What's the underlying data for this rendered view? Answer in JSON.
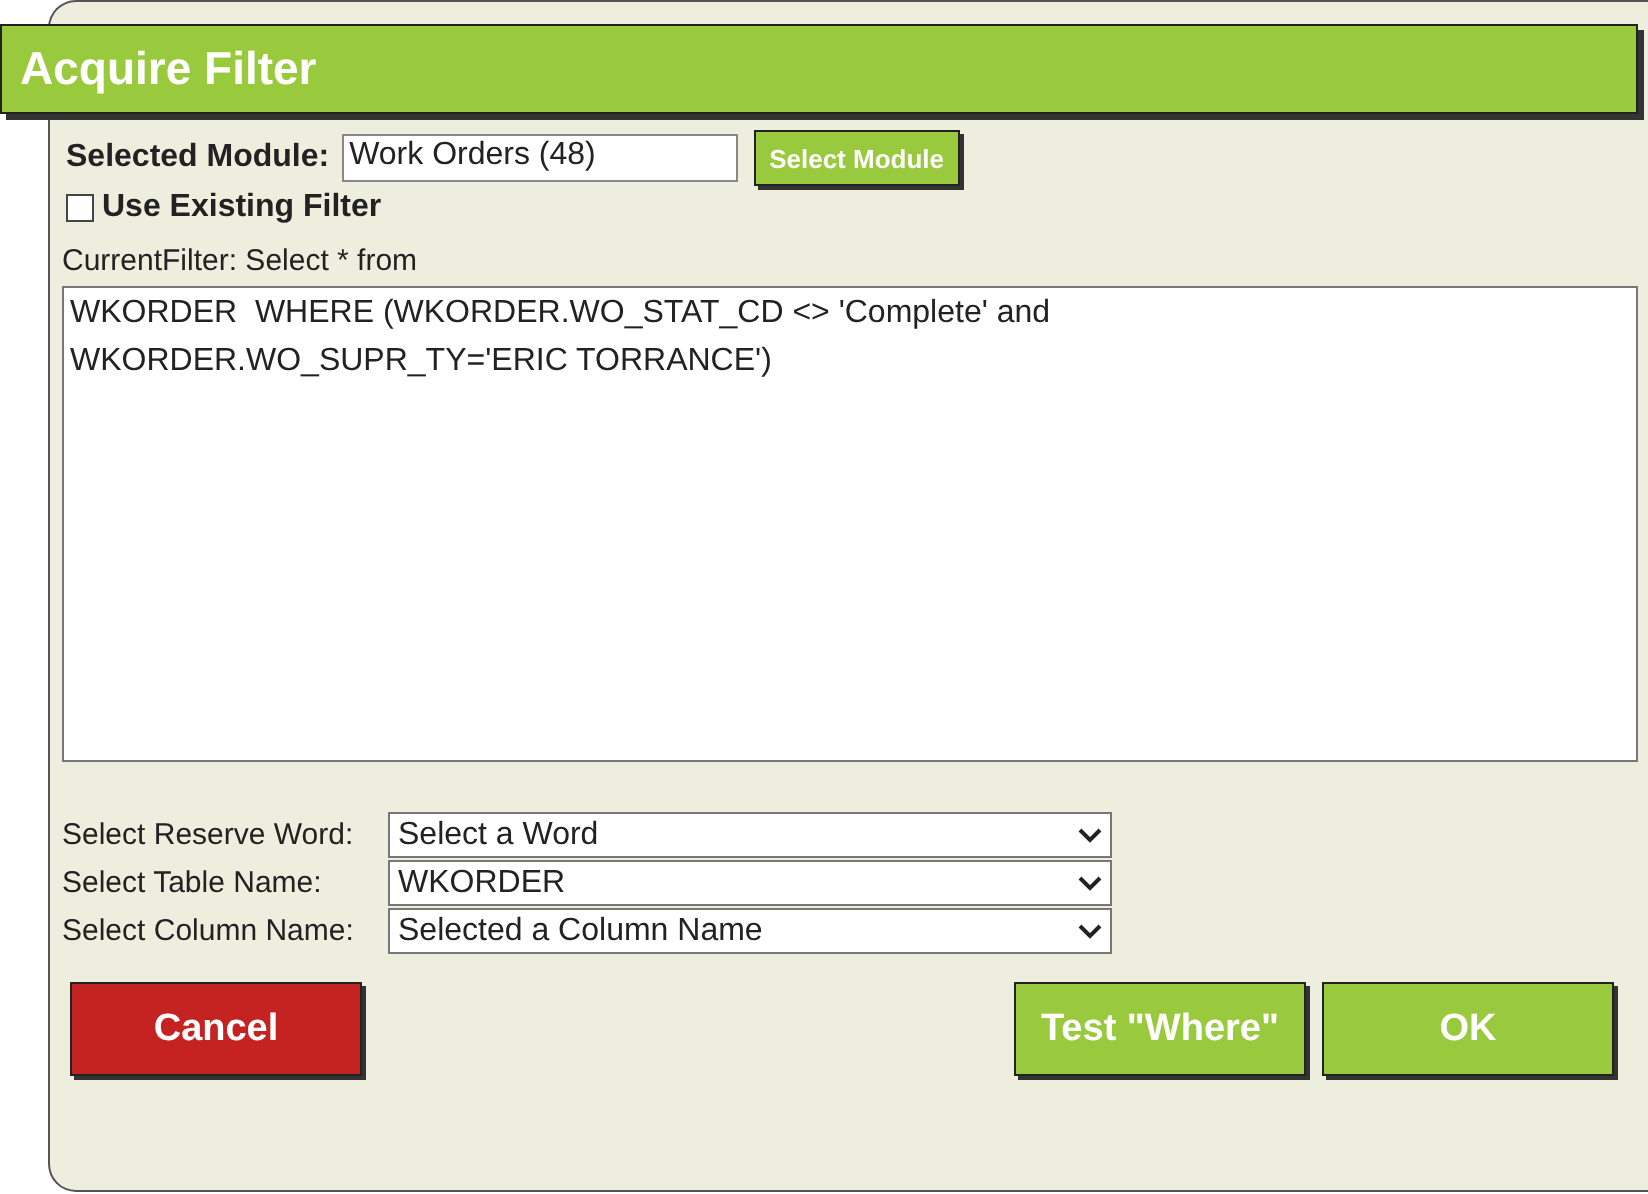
{
  "title": "Acquire Filter",
  "module": {
    "label": "Selected Module:",
    "value": "Work Orders (48)",
    "button": "Select Module"
  },
  "use_existing_filter": {
    "label": "Use Existing Filter",
    "checked": false
  },
  "current_filter": {
    "label": "CurrentFilter: Select * from",
    "value": "WKORDER  WHERE (WKORDER.WO_STAT_CD <> 'Complete' and WKORDER.WO_SUPR_TY='ERIC TORRANCE')"
  },
  "selectors": [
    {
      "label": "Select Reserve Word:",
      "value": "Select a Word"
    },
    {
      "label": "Select Table Name:",
      "value": "WKORDER"
    },
    {
      "label": "Select Column Name:",
      "value": "Selected a Column Name"
    }
  ],
  "buttons": [
    {
      "label": "Cancel",
      "kind": "cancel"
    },
    {
      "label": "Test \"Where\"",
      "kind": "action"
    },
    {
      "label": "OK",
      "kind": "action"
    }
  ]
}
